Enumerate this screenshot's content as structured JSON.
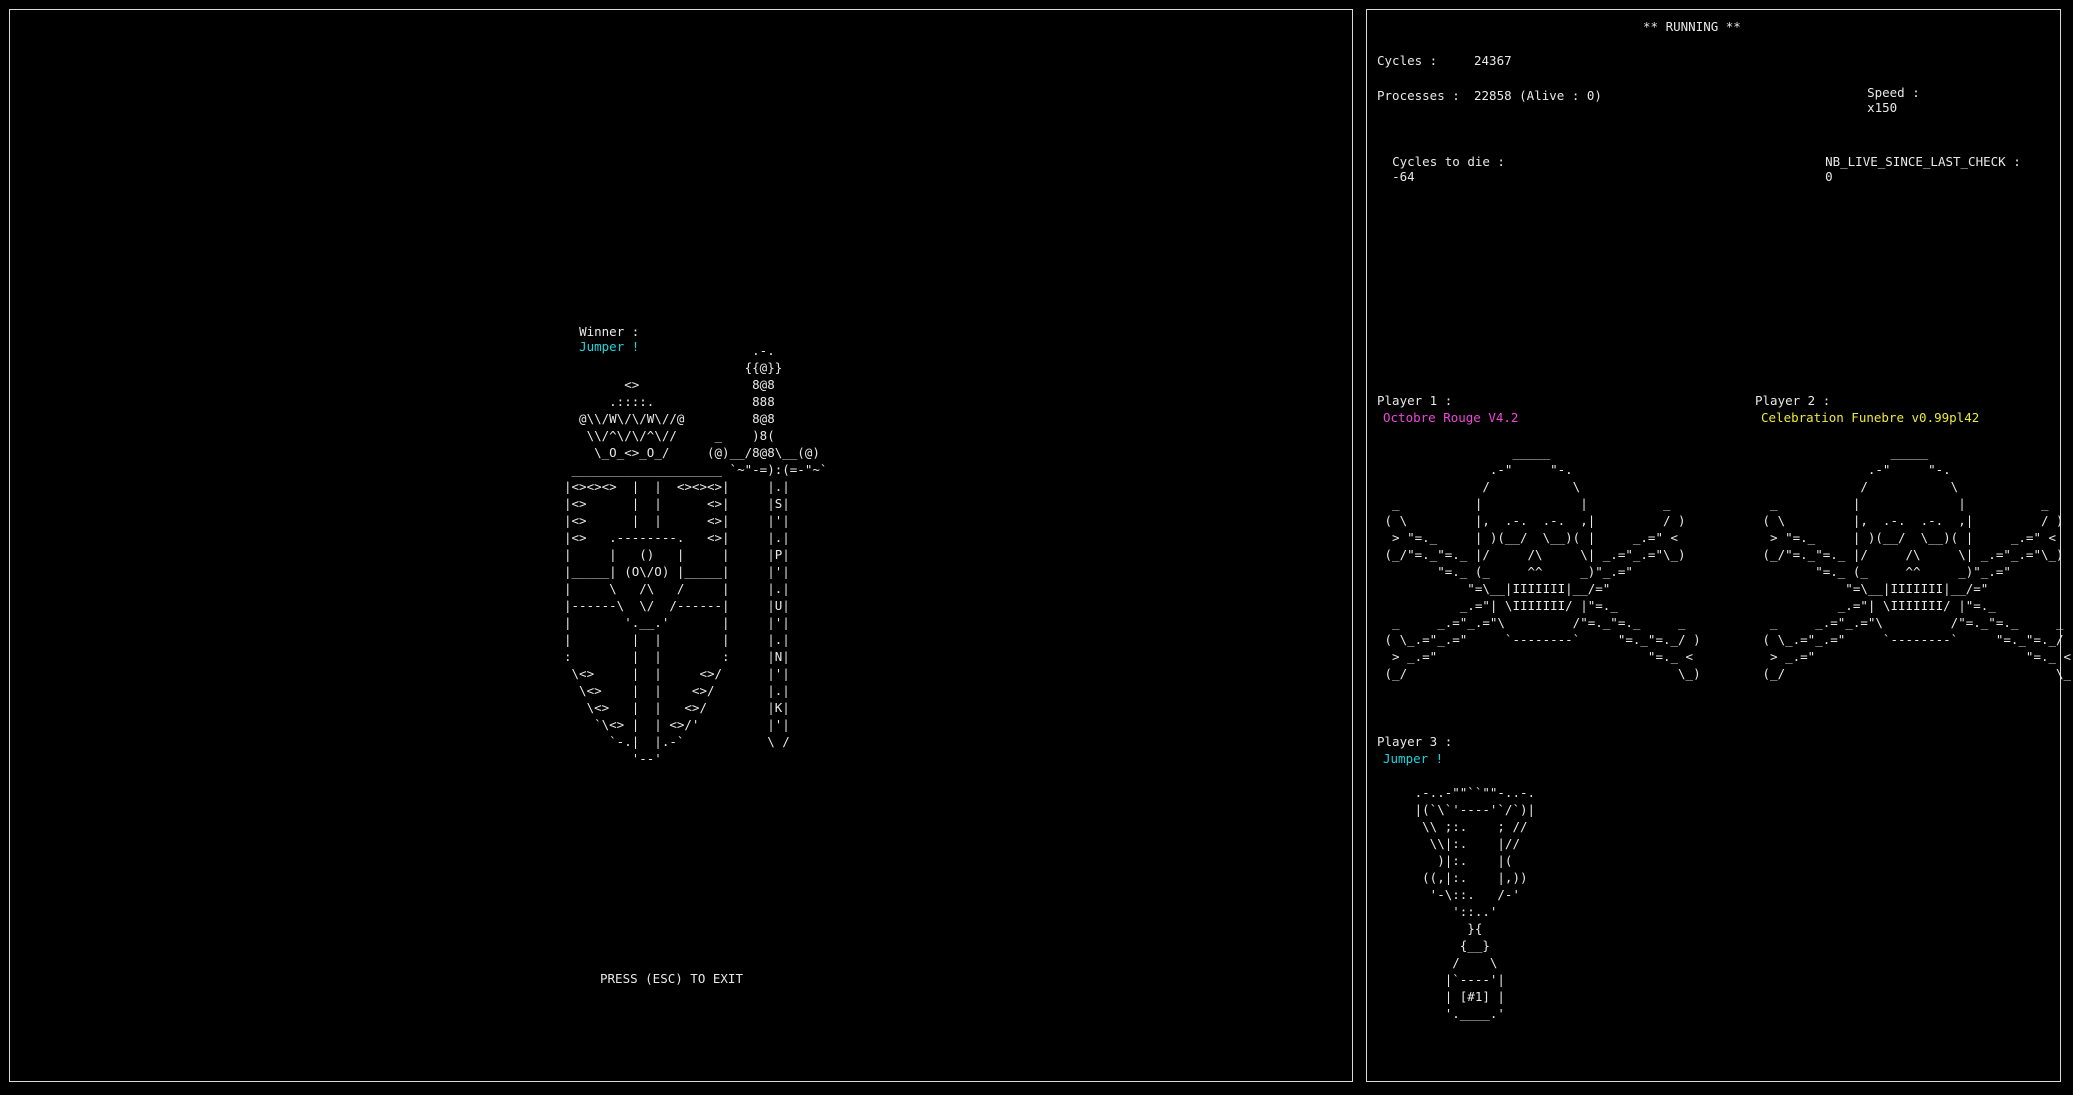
{
  "status": {
    "title": "** RUNNING **"
  },
  "stats": {
    "cycles_label": "Cycles :",
    "cycles_value": "24367",
    "speed_label": "Speed :",
    "speed_value": "x150",
    "processes_label": "Processes :",
    "processes_value": "22858 (Alive : 0)",
    "cycles_to_die_label": "Cycles to die :",
    "cycles_to_die_value": "-64",
    "nb_live_label": "NB_LIVE_SINCE_LAST_CHECK :",
    "nb_live_value": "0"
  },
  "winner": {
    "label": "Winner :",
    "name": "Jumper !",
    "art": "                         .-.\n                        {{@}}\n        <>               8@8\n      .::::.             888\n  @\\\\/W\\/\\/W\\//@         8@8\n   \\\\/^\\/\\/^\\//     _    )8(\n    \\_O_<>_O_/     (@)__/8@8\\__(@)\n ____________________ `~\"-=):(=-\"~`\n|<><><>  |  |  <><><>|     |.|\n|<>      |  |      <>|     |S|\n|<>      |  |      <>|     |'|\n|<>   .--------.   <>|     |.|\n|     |   ()   |     |     |P|\n|_____| (O\\/O) |_____|     |'|\n|     \\   /\\   /     |     |.|\n|------\\  \\/  /------|     |U|\n|       '.__.'       |     |'|\n|        |  |        |     |.|\n:        |  |        :     |N|\n \\<>     |  |     <>/      |'|\n  \\<>    |  |    <>/       |.|\n   \\<>   |  |   <>/        |K|\n    `\\<> |  | <>/'         |'|\n      `-.|  |.-`           \\ /\n         '--'"
  },
  "footer": {
    "exit_hint": "PRESS (ESC) TO EXIT"
  },
  "players": [
    {
      "label": "Player 1 :",
      "name": "Octobre Rouge V4.2",
      "color": "#ee46d9",
      "art": "                  _____\n               .-\"     \"-.\n              /           \\\n  _          |             |          _\n ( \\         |,  .-.  .-.  ,|         / )\n  > \"=._     | )(__/  \\__)( |     _.=\" <\n (_/\"=._\"=._ |/     /\\     \\| _.=\"_.=\"\\_)\n        \"=._ (_     ^^     _)\"_.=\"\n            \"=\\__|IIIIIII|__/=\"\n           _.=\"| \\IIIIIII/ |\"=._\n  _     _.=\"_.=\"\\         /\"=._\"=._     _\n ( \\_.=\"_.=\"     `--------`     \"=._\"=._/ )\n  > _.=\"                            \"=._ <\n (_/                                    \\_)"
    },
    {
      "label": "Player 2 :",
      "name": "Celebration Funebre v0.99pl42",
      "color": "#ecea3a",
      "art": "                  _____\n               .-\"     \"-.\n              /           \\\n  _          |             |          _\n ( \\         |,  .-.  .-.  ,|         / )\n  > \"=._     | )(__/  \\__)( |     _.=\" <\n (_/\"=._\"=._ |/     /\\     \\| _.=\"_.=\"\\_)\n        \"=._ (_     ^^     _)\"_.=\"\n            \"=\\__|IIIIIII|__/=\"\n           _.=\"| \\IIIIIII/ |\"=._\n  _     _.=\"_.=\"\\         /\"=._\"=._     _\n ( \\_.=\"_.=\"     `--------`     \"=._\"=._/ )\n  > _.=\"                            \"=._ <\n (_/                                    \\_)"
    },
    {
      "label": "Player 3 :",
      "name": "Jumper !",
      "color": "#19d3dc",
      "art": "     .-..-\"\"``\"\"-..-.\n     |(`\\`'----'`/`)|\n      \\\\ ;:.    ; //\n       \\\\|:.    |//\n        )|:.    |(\n      ((,|:.    |,))\n       '-\\::.   /-'\n          '::..'\n            }{\n           {__}\n          /    \\\n         |`----'|\n         | [#1] |\n         '.____.'"
    }
  ]
}
